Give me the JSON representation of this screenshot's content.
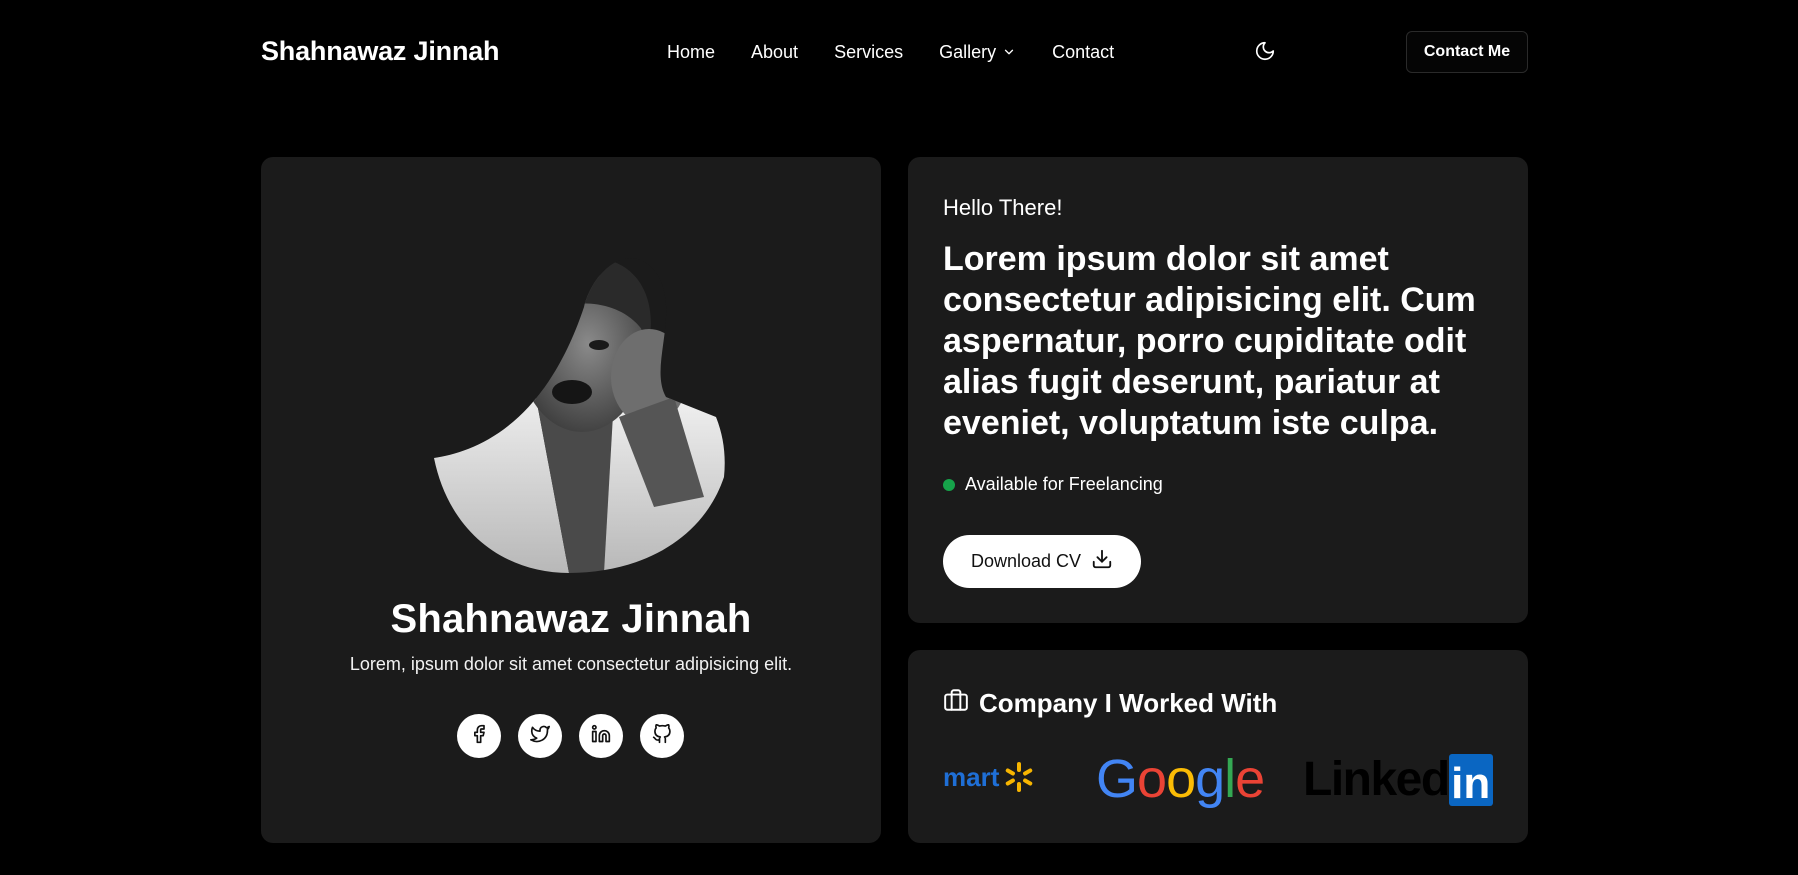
{
  "header": {
    "brand": "Shahnawaz Jinnah",
    "nav": [
      {
        "label": "Home"
      },
      {
        "label": "About"
      },
      {
        "label": "Services"
      },
      {
        "label": "Gallery"
      },
      {
        "label": "Contact"
      }
    ],
    "theme_icon": "moon-icon",
    "contact_button": "Contact Me"
  },
  "profile": {
    "name": "Shahnawaz Jinnah",
    "tagline": "Lorem, ipsum dolor sit amet consectetur adipisicing elit.",
    "socials": [
      {
        "icon": "facebook-icon"
      },
      {
        "icon": "twitter-icon"
      },
      {
        "icon": "linkedin-icon"
      },
      {
        "icon": "github-icon"
      }
    ]
  },
  "hello": {
    "greeting": "Hello There!",
    "headline": "Lorem ipsum dolor sit amet consectetur adipisicing elit. Cum aspernatur, porro cupiditate odit alias fugit deserunt, pariatur at eveniet, voluptatum iste culpa.",
    "availability": "Available for Freelancing",
    "download_button": "Download CV"
  },
  "companies": {
    "title": "Company I Worked With",
    "logos": {
      "walmart": "mart",
      "google": [
        "G",
        "o",
        "o",
        "g",
        "l",
        "e"
      ],
      "linkedin_text": "Linked",
      "linkedin_box": "in"
    }
  },
  "colors": {
    "background": "#000000",
    "card": "#1b1b1b",
    "status": "#16a34a",
    "linkedin": "#0a66c2",
    "walmart_blue": "#1f6fd6",
    "walmart_spark": "#f7b500"
  }
}
